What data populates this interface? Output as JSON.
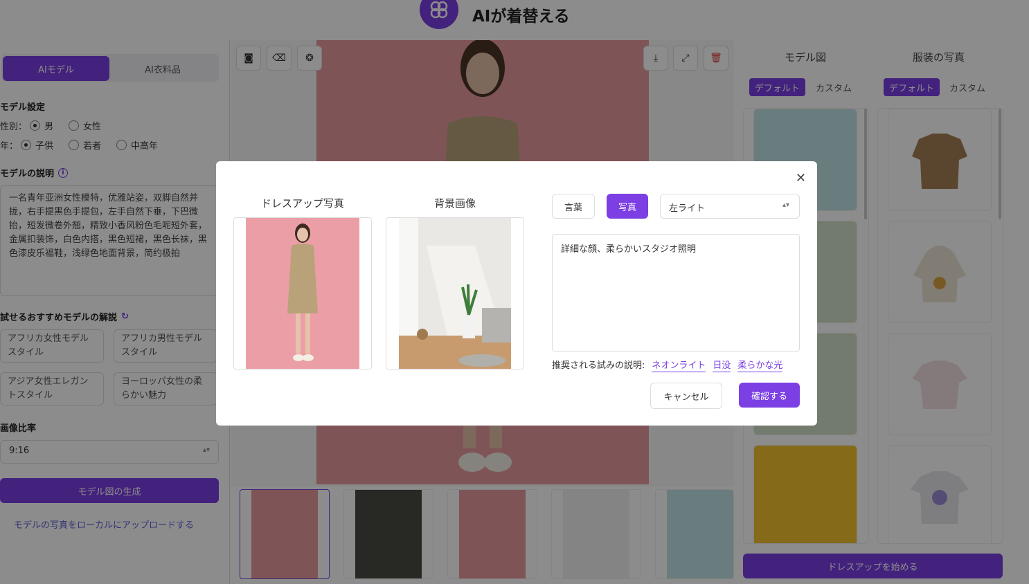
{
  "app": {
    "title": "AIが着替える"
  },
  "left": {
    "tabs": [
      {
        "label": "AIモデル"
      },
      {
        "label": "AI衣料品"
      }
    ],
    "model_settings": {
      "title": "モデル設定",
      "gender_label": "性別：",
      "gender_options": [
        "男",
        "女性"
      ],
      "gender_selected": "男",
      "age_label": "年：",
      "age_options": [
        "子供",
        "若者",
        "中高年"
      ],
      "age_selected": "子供"
    },
    "description": {
      "title": "モデルの説明",
      "text": "一名青年亚洲女性模特，优雅站姿，双脚自然并拢，右手提黑色手提包，左手自然下垂，下巴微抬，短发微卷外翘，精致小香风粉色毛呢短外套，金属扣装饰，白色内搭，黑色短裙，黑色长袜，黑色漆皮乐福鞋，浅绿色地面背景，简约极拍"
    },
    "suggestions": {
      "title": "試せるおすすめモデルの解説",
      "items": [
        "アフリカ女性モデルスタイル",
        "アフリカ男性モデルスタイル",
        "アジア女性エレガントスタイル",
        "ヨーロッパ女性の柔らかい魅力"
      ]
    },
    "ratio": {
      "title": "画像比率",
      "value": "9:16"
    },
    "generate_label": "モデル図の生成",
    "upload_label": "モデルの写真をローカルにアップロードする"
  },
  "center": {
    "tools_left": [
      "stamp-icon",
      "eraser-icon",
      "bulb-icon"
    ],
    "tools_right": [
      "download-icon",
      "expand-icon",
      "trash-icon"
    ]
  },
  "right": {
    "model_col": {
      "title": "モデル図",
      "pill_on": "デフォルト",
      "pill_off": "カスタム"
    },
    "cloth_col": {
      "title": "服装の写真",
      "pill_on": "デフォルト",
      "pill_off": "カスタム"
    },
    "start_label": "ドレスアップを始める"
  },
  "modal": {
    "dress_label": "ドレスアップ写真",
    "bg_label": "背景画像",
    "btn_text": "言葉",
    "btn_photo": "写真",
    "lighting_value": "左ライト",
    "prompt_text": "詳細な顔、柔らかいスタジオ照明",
    "rec_label": "推奨される試みの説明:",
    "rec_items": [
      "ネオンライト",
      "日没",
      "柔らかな光"
    ],
    "cancel_label": "キャンセル",
    "confirm_label": "確認する"
  },
  "colors": {
    "accent": "#7b3fe4",
    "main_bg": "#e89a9e"
  }
}
